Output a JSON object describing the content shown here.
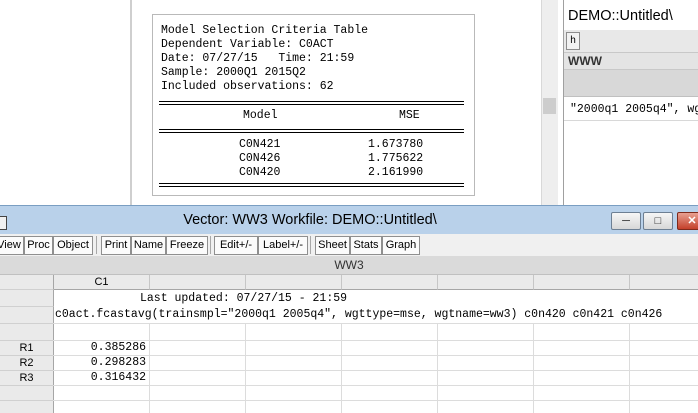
{
  "model_table": {
    "header_lines": [
      "Model Selection Criteria Table",
      "Dependent Variable: C0ACT",
      "Date: 07/27/15   Time: 21:59",
      "Sample: 2000Q1 2015Q2",
      "Included observations: 62"
    ],
    "columns": [
      "Model",
      "MSE"
    ],
    "rows": [
      {
        "model": "C0N421",
        "mse": "1.673780"
      },
      {
        "model": "C0N426",
        "mse": "1.775622"
      },
      {
        "model": "C0N420",
        "mse": "2.161990"
      }
    ]
  },
  "demo_window": {
    "title": "DEMO::Untitled\\",
    "toolbar_button": "h",
    "object_name": "WWW",
    "code_fragment": "\"2000q1 2005q4\", wg"
  },
  "vector_window": {
    "title": "Vector: WW3   Workfile: DEMO::Untitled\\",
    "toolbar": [
      "View",
      "Proc",
      "Object",
      "Print",
      "Name",
      "Freeze",
      "Edit+/-",
      "Label+/-",
      "Sheet",
      "Stats",
      "Graph"
    ],
    "object_name": "WW3",
    "column_header": "C1",
    "last_updated": "Last updated: 07/27/15 - 21:59",
    "command": "c0act.fcastavg(trainsmpl=\"2000q1 2005q4\", wgttype=mse, wgtname=ww3) c0n420 c0n421 c0n426",
    "rows": [
      {
        "label": "R1",
        "value": "0.385286"
      },
      {
        "label": "R2",
        "value": "0.298283"
      },
      {
        "label": "R3",
        "value": "0.316432"
      }
    ]
  },
  "colors": {
    "window_frame": "#b9d1ea",
    "close_button": "#c4402a",
    "toolbar_bg": "#f0f0f0"
  }
}
